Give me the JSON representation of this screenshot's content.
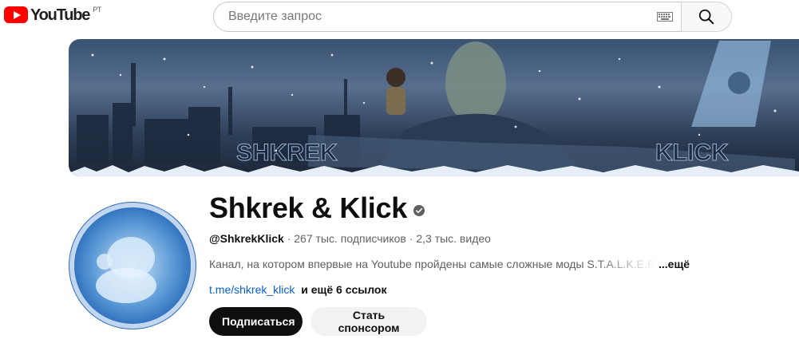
{
  "header": {
    "logo_text": "YouTube",
    "region": "РТ",
    "search_placeholder": "Введите запрос",
    "icons": [
      "youtube-logo-icon",
      "keyboard-icon",
      "search-icon"
    ]
  },
  "banner": {
    "left_text": "SHKREK",
    "right_text": "KLICK"
  },
  "channel": {
    "name": "Shkrek & Klick",
    "verified_icon": "verified-check-icon",
    "handle": "@ShkrekKlick",
    "subscribers": "267 тыс. подписчиков",
    "videos": "2,3 тыс. видео",
    "separator": " · ",
    "description": "Канал, на котором впервые на Youtube  пройдены самые сложные  моды  S.T.A.L.K.E.R.",
    "description_more": "...ещё",
    "link": "t.me/shkrek_klick",
    "more_links": "и ещё 6 ссылок",
    "subscribe_label": "Подписаться",
    "sponsor_label": "Стать спонсором"
  },
  "colors": {
    "brand_red": "#ff0000",
    "link_blue": "#065fd4",
    "subscribe_bg": "#0f0f0f"
  }
}
